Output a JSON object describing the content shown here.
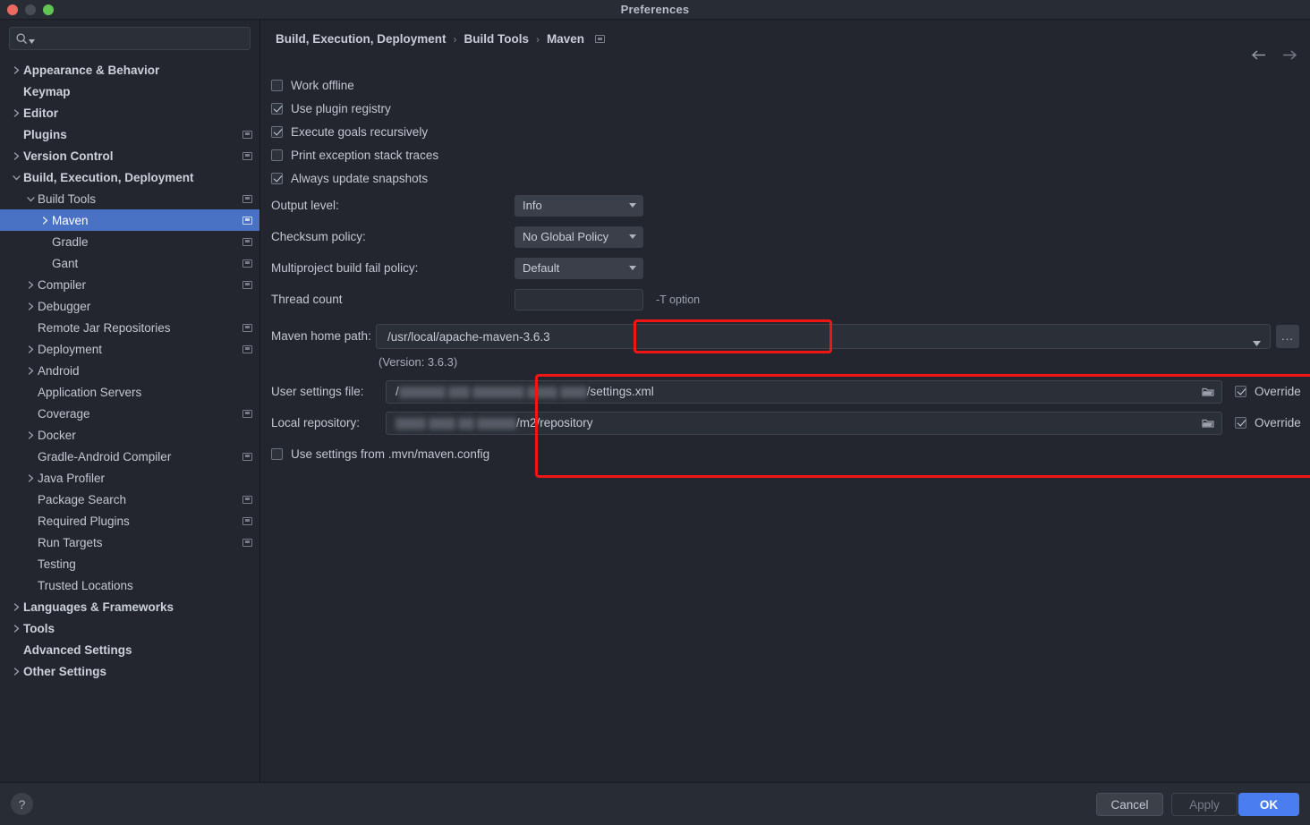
{
  "window": {
    "title": "Preferences",
    "traffic_lights": [
      "close-red",
      "minimize-gray",
      "maximize-green"
    ]
  },
  "sidebar": {
    "search": {
      "placeholder": "",
      "value": "",
      "icon": "search-icon"
    },
    "items": [
      {
        "label": "Appearance & Behavior",
        "arrow": "right",
        "indent": 0,
        "bold": true,
        "badge": false,
        "selected": false
      },
      {
        "label": "Keymap",
        "arrow": "none",
        "indent": 0,
        "bold": true,
        "badge": false,
        "selected": false
      },
      {
        "label": "Editor",
        "arrow": "right",
        "indent": 0,
        "bold": true,
        "badge": false,
        "selected": false
      },
      {
        "label": "Plugins",
        "arrow": "none",
        "indent": 0,
        "bold": true,
        "badge": true,
        "selected": false
      },
      {
        "label": "Version Control",
        "arrow": "right",
        "indent": 0,
        "bold": true,
        "badge": true,
        "selected": false
      },
      {
        "label": "Build, Execution, Deployment",
        "arrow": "down",
        "indent": 0,
        "bold": true,
        "badge": false,
        "selected": false
      },
      {
        "label": "Build Tools",
        "arrow": "down",
        "indent": 1,
        "bold": false,
        "badge": true,
        "selected": false
      },
      {
        "label": "Maven",
        "arrow": "right",
        "indent": 2,
        "bold": false,
        "badge": true,
        "selected": true
      },
      {
        "label": "Gradle",
        "arrow": "none",
        "indent": 2,
        "bold": false,
        "badge": true,
        "selected": false
      },
      {
        "label": "Gant",
        "arrow": "none",
        "indent": 2,
        "bold": false,
        "badge": true,
        "selected": false
      },
      {
        "label": "Compiler",
        "arrow": "right",
        "indent": 1,
        "bold": false,
        "badge": true,
        "selected": false
      },
      {
        "label": "Debugger",
        "arrow": "right",
        "indent": 1,
        "bold": false,
        "badge": false,
        "selected": false
      },
      {
        "label": "Remote Jar Repositories",
        "arrow": "none",
        "indent": 1,
        "bold": false,
        "badge": true,
        "selected": false
      },
      {
        "label": "Deployment",
        "arrow": "right",
        "indent": 1,
        "bold": false,
        "badge": true,
        "selected": false
      },
      {
        "label": "Android",
        "arrow": "right",
        "indent": 1,
        "bold": false,
        "badge": false,
        "selected": false
      },
      {
        "label": "Application Servers",
        "arrow": "none",
        "indent": 1,
        "bold": false,
        "badge": false,
        "selected": false
      },
      {
        "label": "Coverage",
        "arrow": "none",
        "indent": 1,
        "bold": false,
        "badge": true,
        "selected": false
      },
      {
        "label": "Docker",
        "arrow": "right",
        "indent": 1,
        "bold": false,
        "badge": false,
        "selected": false
      },
      {
        "label": "Gradle-Android Compiler",
        "arrow": "none",
        "indent": 1,
        "bold": false,
        "badge": true,
        "selected": false
      },
      {
        "label": "Java Profiler",
        "arrow": "right",
        "indent": 1,
        "bold": false,
        "badge": false,
        "selected": false
      },
      {
        "label": "Package Search",
        "arrow": "none",
        "indent": 1,
        "bold": false,
        "badge": true,
        "selected": false
      },
      {
        "label": "Required Plugins",
        "arrow": "none",
        "indent": 1,
        "bold": false,
        "badge": true,
        "selected": false
      },
      {
        "label": "Run Targets",
        "arrow": "none",
        "indent": 1,
        "bold": false,
        "badge": true,
        "selected": false
      },
      {
        "label": "Testing",
        "arrow": "none",
        "indent": 1,
        "bold": false,
        "badge": false,
        "selected": false
      },
      {
        "label": "Trusted Locations",
        "arrow": "none",
        "indent": 1,
        "bold": false,
        "badge": false,
        "selected": false
      },
      {
        "label": "Languages & Frameworks",
        "arrow": "right",
        "indent": 0,
        "bold": true,
        "badge": false,
        "selected": false
      },
      {
        "label": "Tools",
        "arrow": "right",
        "indent": 0,
        "bold": true,
        "badge": false,
        "selected": false
      },
      {
        "label": "Advanced Settings",
        "arrow": "none",
        "indent": 0,
        "bold": true,
        "badge": false,
        "selected": false
      },
      {
        "label": "Other Settings",
        "arrow": "right",
        "indent": 0,
        "bold": true,
        "badge": false,
        "selected": false
      }
    ]
  },
  "breadcrumb": {
    "parts": [
      "Build, Execution, Deployment",
      "Build Tools",
      "Maven"
    ],
    "separator": "›",
    "badge": true
  },
  "nav": {
    "back_icon": "arrow-left-icon",
    "forward_icon": "arrow-right-icon"
  },
  "main": {
    "checkboxes": [
      {
        "label": "Work offline",
        "checked": false
      },
      {
        "label": "Use plugin registry",
        "checked": true
      },
      {
        "label": "Execute goals recursively",
        "checked": true
      },
      {
        "label": "Print exception stack traces",
        "checked": false
      },
      {
        "label": "Always update snapshots",
        "checked": true
      }
    ],
    "fields": [
      {
        "label": "Output level:",
        "type": "combo",
        "value": "Info"
      },
      {
        "label": "Checksum policy:",
        "type": "combo",
        "value": "No Global Policy"
      },
      {
        "label": "Multiproject build fail policy:",
        "type": "combo",
        "value": "Default"
      },
      {
        "label": "Thread count",
        "type": "text",
        "value": "",
        "hint": "-T option"
      }
    ],
    "maven_home": {
      "label": "Maven home path:",
      "value": "/usr/local/apache-maven-3.6.3",
      "version_text": "(Version: 3.6.3)",
      "ellipsis_label": "...",
      "highlighted": true
    },
    "settings_rows": [
      {
        "label": "User settings file:",
        "redacted_prefix": "/",
        "redacted_blocks": [
          52,
          24,
          58,
          34,
          30
        ],
        "value_suffix": "/settings.xml",
        "override_label": "Override",
        "override_checked": true,
        "folder_icon": "folder-icon"
      },
      {
        "label": "Local repository:",
        "redacted_prefix": "",
        "redacted_blocks": [
          34,
          30,
          18,
          44
        ],
        "value_suffix": "/m2/repository",
        "override_label": "Override",
        "override_checked": true,
        "folder_icon": "folder-icon"
      }
    ],
    "mvn_config": {
      "label": "Use settings from .mvn/maven.config",
      "checked": false
    },
    "highlight_color": "#f01616"
  },
  "footer": {
    "help_label": "?",
    "cancel_label": "Cancel",
    "apply_label": "Apply",
    "ok_label": "OK",
    "accent_color": "#4a7ef0"
  }
}
